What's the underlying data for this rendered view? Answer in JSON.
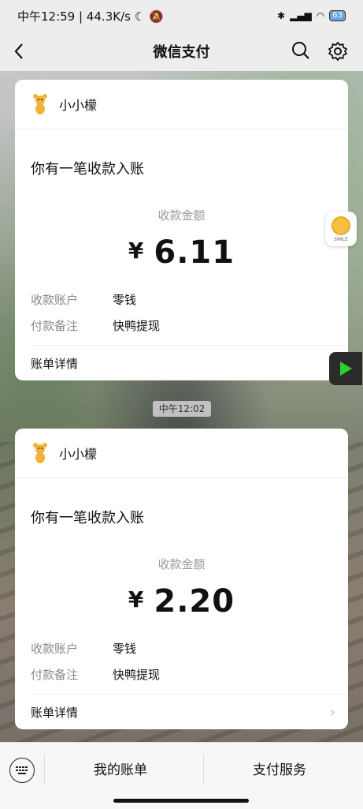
{
  "status": {
    "time": "中午12:59",
    "speed": "44.3K/s",
    "battery": "63"
  },
  "header": {
    "title": "微信支付"
  },
  "cards": [
    {
      "sender": "小小檬",
      "subject": "你有一笔收款入账",
      "amount_label": "收款金额",
      "currency": "¥",
      "amount": "6.11",
      "account_key": "收款账户",
      "account_value": "零钱",
      "note_key": "付款备注",
      "note_value": "快鸭提现",
      "details": "账单详情"
    },
    {
      "sender": "小小檬",
      "subject": "你有一笔收款入账",
      "amount_label": "收款金额",
      "currency": "¥",
      "amount": "2.20",
      "account_key": "收款账户",
      "account_value": "零钱",
      "note_key": "付款备注",
      "note_value": "快鸭提现",
      "details": "账单详情"
    }
  ],
  "timestamp": "中午12:02",
  "float": {
    "smile_label": "SMILE"
  },
  "bottom": {
    "my_bill": "我的账单",
    "pay_service": "支付服务"
  },
  "colors": {
    "header_bg": "#ededed",
    "card_bg": "#ffffff",
    "accent_green": "#1aad19"
  },
  "icons": [
    "back-arrow-icon",
    "search-icon",
    "gear-icon",
    "mascot-avatar-icon",
    "chevron-right-icon",
    "keyboard-icon",
    "play-icon",
    "coin-icon"
  ]
}
